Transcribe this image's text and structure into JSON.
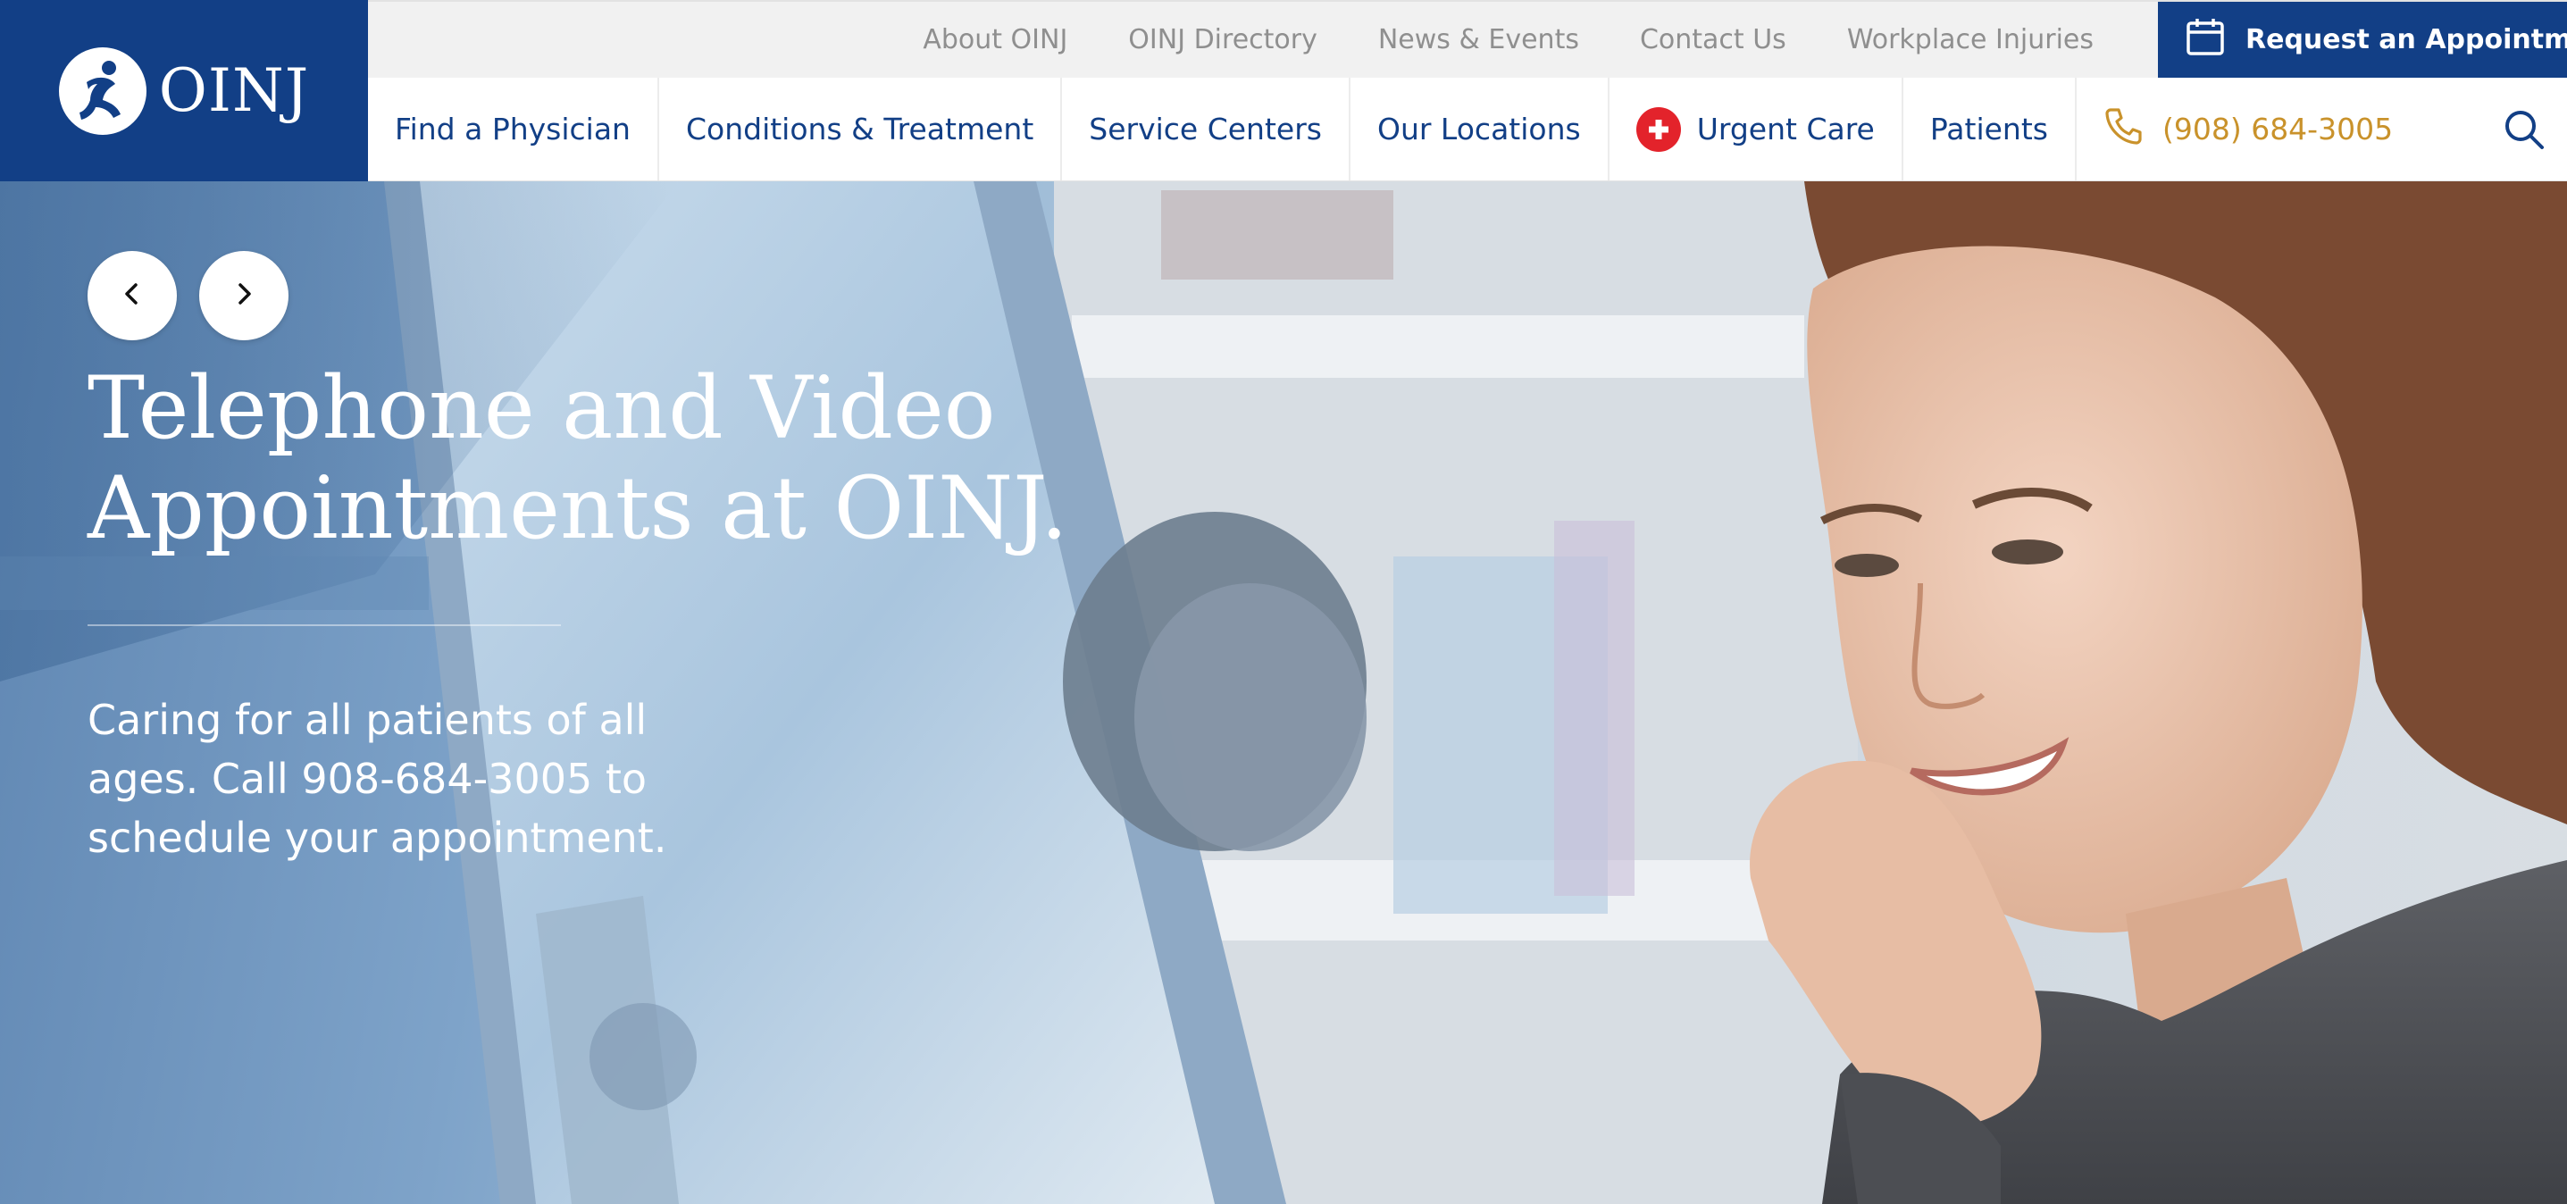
{
  "brand": {
    "logo_text": "OINJ",
    "logo_icon": "running-figure-emblem-icon",
    "color": "#123f86"
  },
  "utility_nav": {
    "links": [
      "About OINJ",
      "OINJ Directory",
      "News & Events",
      "Contact Us",
      "Workplace Injuries"
    ],
    "appointment_button": {
      "label": "Request an Appointment",
      "icon": "calendar-icon"
    }
  },
  "main_nav": {
    "items": [
      "Find a Physician",
      "Conditions & Treatment",
      "Service Centers",
      "Our Locations",
      "Urgent Care",
      "Patients"
    ],
    "urgent_icon": "medical-cross-icon",
    "urgent_color": "#e3232b",
    "phone": {
      "label": "(908) 684-3005",
      "icon": "phone-icon",
      "color": "#c9922b"
    },
    "search_icon": "search-icon"
  },
  "hero": {
    "title_line1": "Telephone and Video",
    "title_line2": "Appointments at OINJ.",
    "subtitle_line1": "Caring for all patients of all",
    "subtitle_line2": "ages. Call 908-684-3005 to",
    "subtitle_line3": "schedule your appointment.",
    "prev_icon": "chevron-left-icon",
    "next_icon": "chevron-right-icon"
  }
}
